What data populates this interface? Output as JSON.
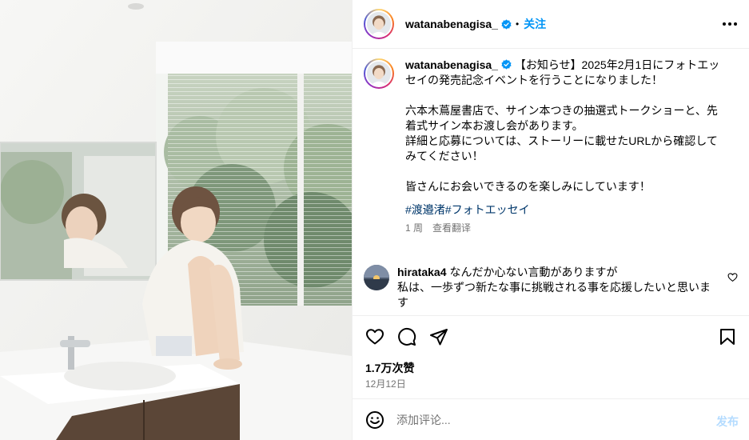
{
  "post": {
    "image_alt": "",
    "header": {
      "username": "watanabenagisa_",
      "separator": "•",
      "follow_label": "关注"
    },
    "caption": {
      "username": "watanabenagisa_",
      "paragraph_1": "【お知らせ】2025年2月1日にフォトエッセイの発売記念イベントを行うことになりました！",
      "paragraph_2": "六本木蔦屋書店で、サイン本つきの抽選式トークショーと、先着式サイン本お渡し会があります。\n詳細と応募については、ストーリーに載せたURLから確認してみてください！",
      "paragraph_3": "皆さんにお会いできるのを楽しみにしています！",
      "hashtags": [
        "#渡邉渚",
        "#フォトエッセイ"
      ],
      "age": "1 周",
      "translate_label": "查看翻译"
    },
    "comment": {
      "username": "hirataka4",
      "text": "なんだか心ない言動がありますが\n私は、一歩ずつ新たな事に挑戦される事を応援したいと思います"
    },
    "likes": "1.7万次赞",
    "date": "12月12日",
    "add_comment": {
      "placeholder": "添加评论...",
      "post_label": "发布"
    }
  },
  "colors": {
    "link": "#0095f6",
    "hashtag": "#00376b",
    "muted": "#737373",
    "verified": "#0095f6",
    "post_disabled": "#b3dbff"
  },
  "icons": [
    "verified-icon",
    "more-icon",
    "heart-icon",
    "comment-icon",
    "share-icon",
    "bookmark-icon",
    "emoji-icon"
  ]
}
